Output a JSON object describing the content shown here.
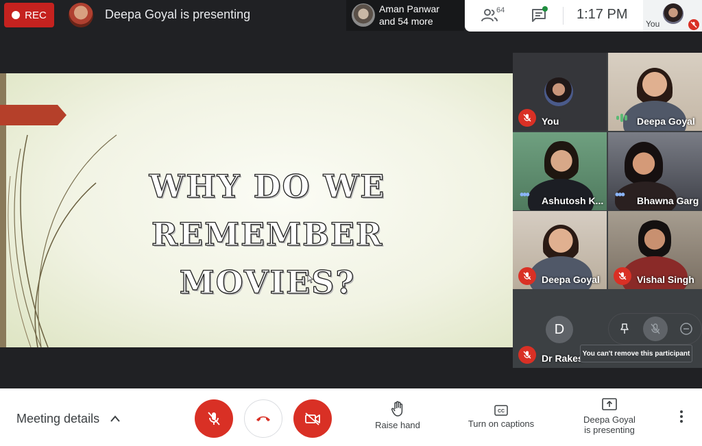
{
  "topbar": {
    "rec_label": "REC",
    "presenting_text": "Deepa Goyal is presenting",
    "others_name": "Aman Panwar",
    "others_more": "and 54 more",
    "people_count": "64",
    "clock": "1:17 PM",
    "me_label": "You"
  },
  "slide": {
    "title_line1": "WHY DO WE",
    "title_line2": "REMEMBER MOVIES?"
  },
  "tiles": [
    {
      "name": "You"
    },
    {
      "name": "Deepa Goyal"
    },
    {
      "name": "Ashutosh K..."
    },
    {
      "name": "Bhawna Garg"
    },
    {
      "name": "Deepa Goyal"
    },
    {
      "name": "Vishal Singh"
    },
    {
      "name": "Dr Rakes",
      "initial": "D"
    }
  ],
  "tooltip": "You can't remove this participant",
  "bottombar": {
    "meeting_details": "Meeting details",
    "raise_hand": "Raise hand",
    "captions": "Turn on captions",
    "presenting_line1": "Deepa Goyal",
    "presenting_line2": "is presenting"
  },
  "colors": {
    "accent_red": "#d93025",
    "rec_red": "#c5221f",
    "talking_green": "#5bb974",
    "chat_dot_green": "#1e8e3e",
    "background_dark": "#202124"
  }
}
